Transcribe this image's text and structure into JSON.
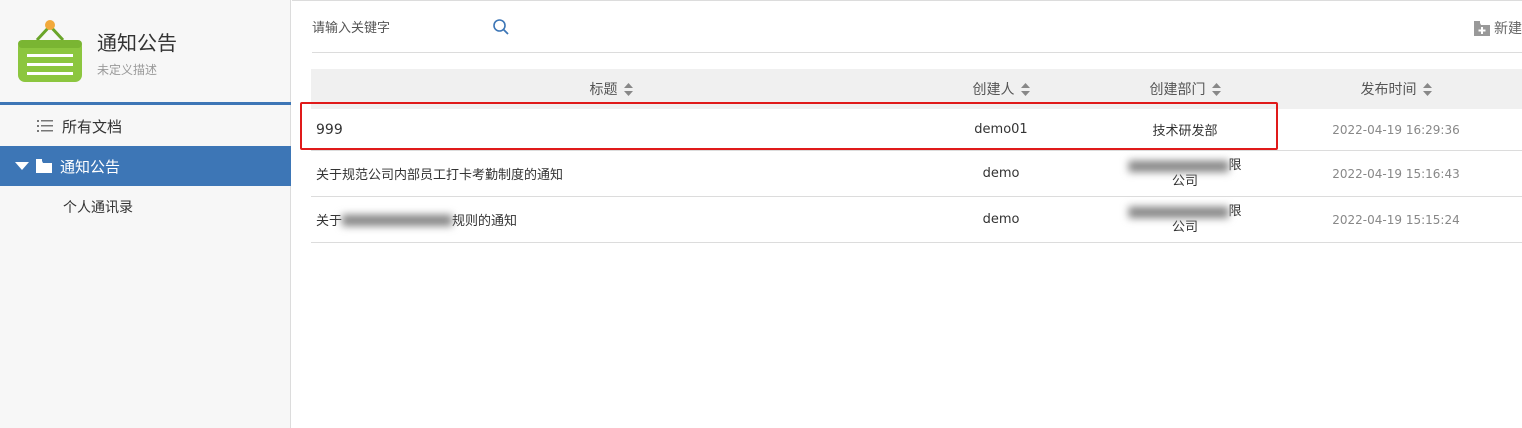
{
  "sidebar": {
    "title": "通知公告",
    "description": "未定义描述",
    "items": [
      {
        "label": "所有文档",
        "icon": "list-icon"
      },
      {
        "label": "通知公告",
        "icon": "folder-icon",
        "active": true
      },
      {
        "label": "个人通讯录"
      }
    ]
  },
  "toolbar": {
    "search_placeholder": "请输入关键字",
    "new_label": "新建"
  },
  "table": {
    "columns": [
      "标题",
      "创建人",
      "创建部门",
      "发布时间"
    ],
    "rows": [
      {
        "title": "999",
        "creator": "demo01",
        "dept": "技术研发部",
        "time": "2022-04-19 16:29:36"
      },
      {
        "title": "关于规范公司内部员工打卡考勤制度的通知",
        "creator": "demo",
        "dept_visible_tail": "限",
        "dept_line2": "公司",
        "time": "2022-04-19 15:16:43"
      },
      {
        "title_prefix": "关于",
        "title_suffix": "规则的通知",
        "creator": "demo",
        "dept_visible_tail": "限",
        "dept_line2": "公司",
        "time": "2022-04-19 15:15:24"
      }
    ]
  },
  "colors": {
    "accent": "#3d76b6",
    "logo_green": "#8cc63f",
    "highlight": "#e01a1a"
  }
}
